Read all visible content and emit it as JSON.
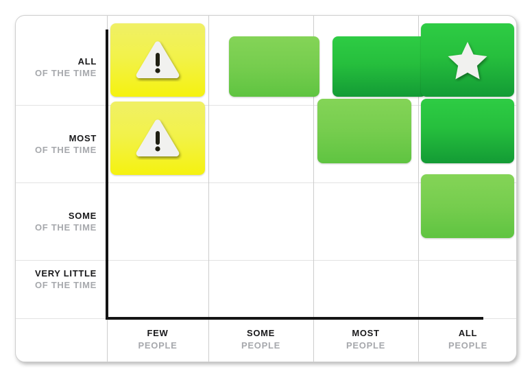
{
  "chart_data": {
    "type": "heatmap",
    "title": "",
    "xlabel": "",
    "ylabel": "",
    "x_axis": {
      "categories": [
        {
          "main": "FEW",
          "sub": "PEOPLE"
        },
        {
          "main": "SOME",
          "sub": "PEOPLE"
        },
        {
          "main": "MOST",
          "sub": "PEOPLE"
        },
        {
          "main": "ALL",
          "sub": "PEOPLE"
        }
      ]
    },
    "y_axis": {
      "categories": [
        {
          "main": "ALL",
          "sub": "OF THE TIME"
        },
        {
          "main": "MOST",
          "sub": "OF THE TIME"
        },
        {
          "main": "SOME",
          "sub": "OF THE TIME"
        },
        {
          "main": "VERY LITTLE",
          "sub": "OF THE TIME"
        }
      ]
    },
    "legend": [
      {
        "key": "yellow",
        "color": "#f2f24a",
        "icon": "warning-icon"
      },
      {
        "key": "lightgreen",
        "color": "#76cd4e",
        "icon": ""
      },
      {
        "key": "darkgreen",
        "color": "#26bf3d",
        "icon": "star-icon"
      }
    ],
    "cells": [
      {
        "row": "ALL",
        "col": "FEW",
        "fill": "yellow",
        "icon": "warning-icon"
      },
      {
        "row": "ALL",
        "col": "SOME",
        "fill": "lightgreen",
        "icon": ""
      },
      {
        "row": "ALL",
        "col": "MOST",
        "fill": "darkgreen",
        "icon": ""
      },
      {
        "row": "ALL",
        "col": "ALL",
        "fill": "darkgreen",
        "icon": "star-icon"
      },
      {
        "row": "MOST",
        "col": "FEW",
        "fill": "yellow",
        "icon": "warning-icon"
      },
      {
        "row": "MOST",
        "col": "SOME",
        "fill": "",
        "icon": ""
      },
      {
        "row": "MOST",
        "col": "MOST",
        "fill": "lightgreen",
        "icon": ""
      },
      {
        "row": "MOST",
        "col": "ALL",
        "fill": "darkgreen",
        "icon": ""
      },
      {
        "row": "SOME",
        "col": "FEW",
        "fill": "",
        "icon": ""
      },
      {
        "row": "SOME",
        "col": "SOME",
        "fill": "",
        "icon": ""
      },
      {
        "row": "SOME",
        "col": "MOST",
        "fill": "",
        "icon": ""
      },
      {
        "row": "SOME",
        "col": "ALL",
        "fill": "lightgreen",
        "icon": ""
      },
      {
        "row": "VERY LITTLE",
        "col": "FEW",
        "fill": "",
        "icon": ""
      },
      {
        "row": "VERY LITTLE",
        "col": "SOME",
        "fill": "",
        "icon": ""
      },
      {
        "row": "VERY LITTLE",
        "col": "MOST",
        "fill": "",
        "icon": ""
      },
      {
        "row": "VERY LITTLE",
        "col": "ALL",
        "fill": "",
        "icon": ""
      }
    ],
    "grid": true,
    "axis_color": "#141414",
    "gridline_color": "#e2e2e2"
  },
  "matrix": {
    "rows": [
      {
        "main": "ALL",
        "sub": "OF THE TIME"
      },
      {
        "main": "MOST",
        "sub": "OF THE TIME"
      },
      {
        "main": "SOME",
        "sub": "OF THE TIME"
      },
      {
        "main": "VERY LITTLE",
        "sub": "OF THE TIME"
      }
    ],
    "cols": [
      {
        "main": "FEW",
        "sub": "PEOPLE"
      },
      {
        "main": "SOME",
        "sub": "PEOPLE"
      },
      {
        "main": "MOST",
        "sub": "PEOPLE"
      },
      {
        "main": "ALL",
        "sub": "PEOPLE"
      }
    ],
    "icons": {
      "warning": "warning-icon",
      "star": "star-icon"
    }
  }
}
